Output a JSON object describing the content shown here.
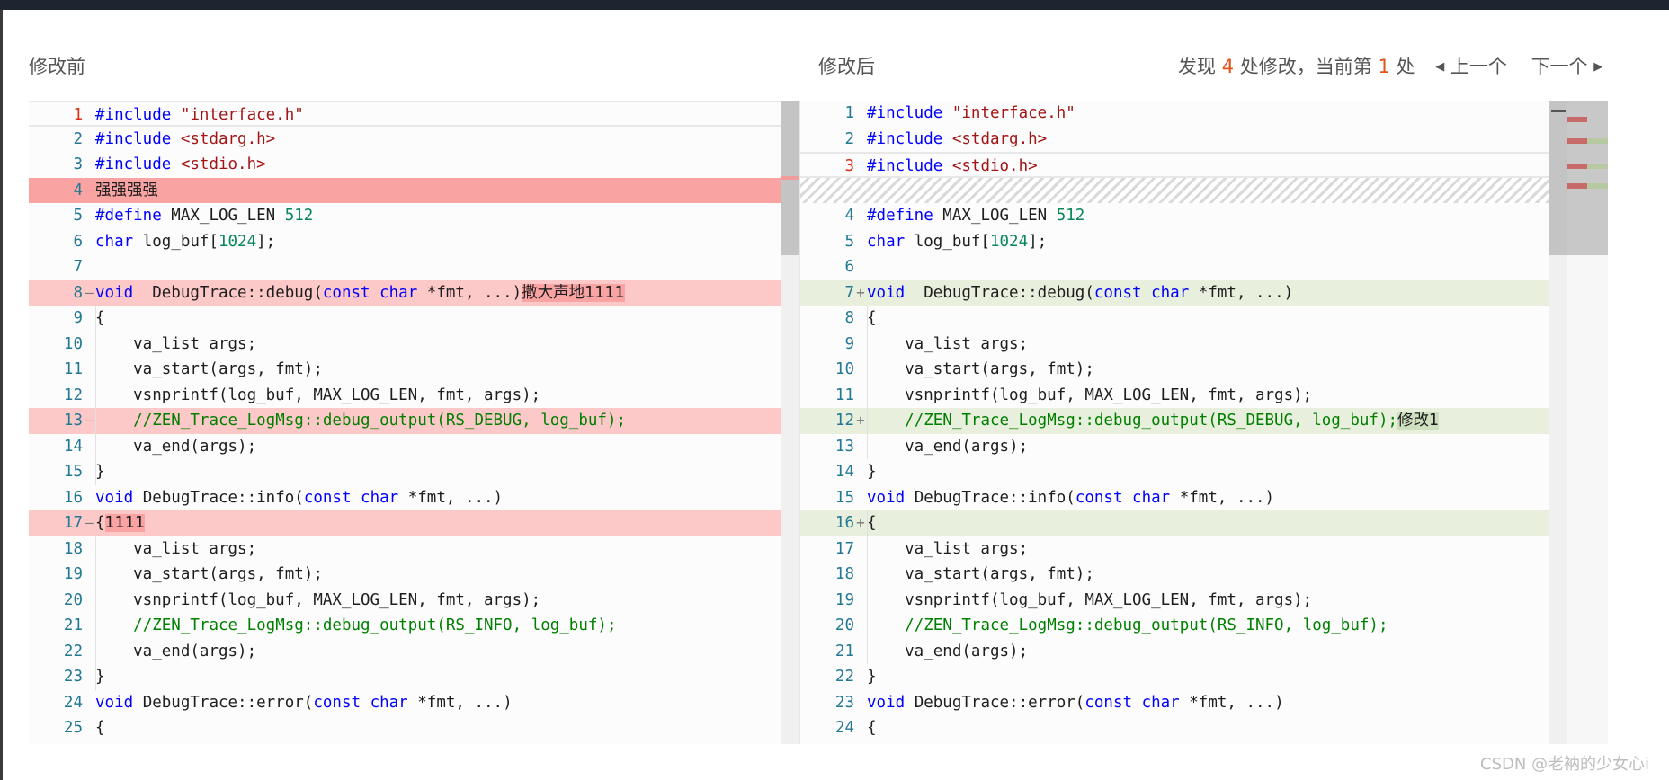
{
  "left_panel": {
    "title": "修改前"
  },
  "right_panel": {
    "title": "修改后"
  },
  "nav": {
    "prefix": "发现",
    "count": "4",
    "middle": "处修改，当前第",
    "current": "1",
    "suffix": "处",
    "prev_label": "上一个",
    "next_label": "下一个",
    "prev_icon": "caret-left-icon",
    "next_icon": "caret-right-icon"
  },
  "colors": {
    "deleted_line": "#fdc8c8",
    "deleted_char": "#f9a3a3",
    "inserted_line": "#e8efdc",
    "line_number": "#237893",
    "active_line_number": "#e02b15",
    "keyword": "#0000ff",
    "string": "#a31515",
    "number": "#098658",
    "comment": "#008000",
    "nav_highlight": "#e5511c"
  },
  "left_lines": [
    {
      "n": "1",
      "mark": "",
      "type": "cur",
      "active": true,
      "tokens": [
        [
          "kw",
          "#include"
        ],
        [
          "t",
          " "
        ],
        [
          "str",
          "\"interface.h\""
        ]
      ]
    },
    {
      "n": "2",
      "mark": "",
      "type": "",
      "tokens": [
        [
          "kw",
          "#include"
        ],
        [
          "t",
          " "
        ],
        [
          "str",
          "<stdarg.h>"
        ]
      ]
    },
    {
      "n": "3",
      "mark": "",
      "type": "",
      "tokens": [
        [
          "kw",
          "#include"
        ],
        [
          "t",
          " "
        ],
        [
          "str",
          "<stdio.h>"
        ]
      ]
    },
    {
      "n": "4",
      "mark": "—",
      "type": "del-strong",
      "tokens": [
        [
          "cjk",
          "强强强强"
        ]
      ]
    },
    {
      "n": "5",
      "mark": "",
      "type": "",
      "tokens": [
        [
          "kw",
          "#define"
        ],
        [
          "t",
          " MAX_LOG_LEN "
        ],
        [
          "num",
          "512"
        ]
      ]
    },
    {
      "n": "6",
      "mark": "",
      "type": "",
      "tokens": [
        [
          "kw",
          "char"
        ],
        [
          "t",
          " log_buf["
        ],
        [
          "num",
          "1024"
        ],
        [
          "t",
          "];"
        ]
      ]
    },
    {
      "n": "7",
      "mark": "",
      "type": "",
      "tokens": []
    },
    {
      "n": "8",
      "mark": "—",
      "type": "del",
      "tokens": [
        [
          "kw",
          "void"
        ],
        [
          "t",
          "  DebugTrace::debug("
        ],
        [
          "kw",
          "const"
        ],
        [
          "t",
          " "
        ],
        [
          "kw",
          "char"
        ],
        [
          "t",
          " *fmt, ...)"
        ],
        [
          "del",
          "撒大声地1111"
        ]
      ]
    },
    {
      "n": "9",
      "mark": "",
      "type": "",
      "tokens": [
        [
          "t",
          "{"
        ]
      ]
    },
    {
      "n": "10",
      "mark": "",
      "type": "",
      "tokens": [
        [
          "t",
          "    va_list args;"
        ]
      ]
    },
    {
      "n": "11",
      "mark": "",
      "type": "",
      "tokens": [
        [
          "t",
          "    va_start(args, fmt);"
        ]
      ]
    },
    {
      "n": "12",
      "mark": "",
      "type": "",
      "tokens": [
        [
          "t",
          "    vsnprintf(log_buf, MAX_LOG_LEN, fmt, args);"
        ]
      ]
    },
    {
      "n": "13",
      "mark": "—",
      "type": "del",
      "tokens": [
        [
          "t",
          "    "
        ],
        [
          "cmt",
          "//ZEN_Trace_LogMsg::debug_output(RS_DEBUG, log_buf);"
        ]
      ]
    },
    {
      "n": "14",
      "mark": "",
      "type": "",
      "tokens": [
        [
          "t",
          "    va_end(args);"
        ]
      ]
    },
    {
      "n": "15",
      "mark": "",
      "type": "",
      "tokens": [
        [
          "t",
          "}"
        ]
      ]
    },
    {
      "n": "16",
      "mark": "",
      "type": "",
      "tokens": [
        [
          "kw",
          "void"
        ],
        [
          "t",
          " DebugTrace::info("
        ],
        [
          "kw",
          "const"
        ],
        [
          "t",
          " "
        ],
        [
          "kw",
          "char"
        ],
        [
          "t",
          " *fmt, ...)"
        ]
      ]
    },
    {
      "n": "17",
      "mark": "—",
      "type": "del",
      "tokens": [
        [
          "t",
          "{"
        ],
        [
          "del",
          "1111"
        ]
      ]
    },
    {
      "n": "18",
      "mark": "",
      "type": "",
      "tokens": [
        [
          "t",
          "    va_list args;"
        ]
      ]
    },
    {
      "n": "19",
      "mark": "",
      "type": "",
      "tokens": [
        [
          "t",
          "    va_start(args, fmt);"
        ]
      ]
    },
    {
      "n": "20",
      "mark": "",
      "type": "",
      "tokens": [
        [
          "t",
          "    vsnprintf(log_buf, MAX_LOG_LEN, fmt, args);"
        ]
      ]
    },
    {
      "n": "21",
      "mark": "",
      "type": "",
      "tokens": [
        [
          "t",
          "    "
        ],
        [
          "cmt",
          "//ZEN_Trace_LogMsg::debug_output(RS_INFO, log_buf);"
        ]
      ]
    },
    {
      "n": "22",
      "mark": "",
      "type": "",
      "tokens": [
        [
          "t",
          "    va_end(args);"
        ]
      ]
    },
    {
      "n": "23",
      "mark": "",
      "type": "",
      "tokens": [
        [
          "t",
          "}"
        ]
      ]
    },
    {
      "n": "24",
      "mark": "",
      "type": "",
      "tokens": [
        [
          "kw",
          "void"
        ],
        [
          "t",
          " DebugTrace::error("
        ],
        [
          "kw",
          "const"
        ],
        [
          "t",
          " "
        ],
        [
          "kw",
          "char"
        ],
        [
          "t",
          " *fmt, ...)"
        ]
      ]
    },
    {
      "n": "25",
      "mark": "",
      "type": "",
      "tokens": [
        [
          "t",
          "{"
        ]
      ]
    }
  ],
  "right_lines": [
    {
      "n": "1",
      "mark": "",
      "type": "",
      "tokens": [
        [
          "kw",
          "#include"
        ],
        [
          "t",
          " "
        ],
        [
          "str",
          "\"interface.h\""
        ]
      ]
    },
    {
      "n": "2",
      "mark": "",
      "type": "",
      "tokens": [
        [
          "kw",
          "#include"
        ],
        [
          "t",
          " "
        ],
        [
          "str",
          "<stdarg.h>"
        ]
      ]
    },
    {
      "n": "3",
      "mark": "",
      "type": "cur",
      "active": true,
      "tokens": [
        [
          "kw",
          "#include"
        ],
        [
          "t",
          " "
        ],
        [
          "str",
          "<stdio.h>"
        ]
      ]
    },
    {
      "n": "",
      "mark": "",
      "type": "filler",
      "tokens": []
    },
    {
      "n": "4",
      "mark": "",
      "type": "",
      "tokens": [
        [
          "kw",
          "#define"
        ],
        [
          "t",
          " MAX_LOG_LEN "
        ],
        [
          "num",
          "512"
        ]
      ]
    },
    {
      "n": "5",
      "mark": "",
      "type": "",
      "tokens": [
        [
          "kw",
          "char"
        ],
        [
          "t",
          " log_buf["
        ],
        [
          "num",
          "1024"
        ],
        [
          "t",
          "];"
        ]
      ]
    },
    {
      "n": "6",
      "mark": "",
      "type": "",
      "tokens": []
    },
    {
      "n": "7",
      "mark": "+",
      "type": "ins",
      "tokens": [
        [
          "kw",
          "void"
        ],
        [
          "t",
          "  DebugTrace::debug("
        ],
        [
          "kw",
          "const"
        ],
        [
          "t",
          " "
        ],
        [
          "kw",
          "char"
        ],
        [
          "t",
          " *fmt, ...)"
        ]
      ]
    },
    {
      "n": "8",
      "mark": "",
      "type": "",
      "tokens": [
        [
          "t",
          "{"
        ]
      ]
    },
    {
      "n": "9",
      "mark": "",
      "type": "",
      "tokens": [
        [
          "t",
          "    va_list args;"
        ]
      ]
    },
    {
      "n": "10",
      "mark": "",
      "type": "",
      "tokens": [
        [
          "t",
          "    va_start(args, fmt);"
        ]
      ]
    },
    {
      "n": "11",
      "mark": "",
      "type": "",
      "tokens": [
        [
          "t",
          "    vsnprintf(log_buf, MAX_LOG_LEN, fmt, args);"
        ]
      ]
    },
    {
      "n": "12",
      "mark": "+",
      "type": "ins",
      "tokens": [
        [
          "t",
          "    "
        ],
        [
          "cmt",
          "//ZEN_Trace_LogMsg::debug_output(RS_DEBUG, log_buf);"
        ],
        [
          "ins",
          "修改1"
        ]
      ]
    },
    {
      "n": "13",
      "mark": "",
      "type": "",
      "tokens": [
        [
          "t",
          "    va_end(args);"
        ]
      ]
    },
    {
      "n": "14",
      "mark": "",
      "type": "",
      "tokens": [
        [
          "t",
          "}"
        ]
      ]
    },
    {
      "n": "15",
      "mark": "",
      "type": "",
      "tokens": [
        [
          "kw",
          "void"
        ],
        [
          "t",
          " DebugTrace::info("
        ],
        [
          "kw",
          "const"
        ],
        [
          "t",
          " "
        ],
        [
          "kw",
          "char"
        ],
        [
          "t",
          " *fmt, ...)"
        ]
      ]
    },
    {
      "n": "16",
      "mark": "+",
      "type": "ins",
      "tokens": [
        [
          "t",
          "{"
        ]
      ]
    },
    {
      "n": "17",
      "mark": "",
      "type": "",
      "tokens": [
        [
          "t",
          "    va_list args;"
        ]
      ]
    },
    {
      "n": "18",
      "mark": "",
      "type": "",
      "tokens": [
        [
          "t",
          "    va_start(args, fmt);"
        ]
      ]
    },
    {
      "n": "19",
      "mark": "",
      "type": "",
      "tokens": [
        [
          "t",
          "    vsnprintf(log_buf, MAX_LOG_LEN, fmt, args);"
        ]
      ]
    },
    {
      "n": "20",
      "mark": "",
      "type": "",
      "tokens": [
        [
          "t",
          "    "
        ],
        [
          "cmt",
          "//ZEN_Trace_LogMsg::debug_output(RS_INFO, log_buf);"
        ]
      ]
    },
    {
      "n": "21",
      "mark": "",
      "type": "",
      "tokens": [
        [
          "t",
          "    va_end(args);"
        ]
      ]
    },
    {
      "n": "22",
      "mark": "",
      "type": "",
      "tokens": [
        [
          "t",
          "}"
        ]
      ]
    },
    {
      "n": "23",
      "mark": "",
      "type": "",
      "tokens": [
        [
          "kw",
          "void"
        ],
        [
          "t",
          " DebugTrace::error("
        ],
        [
          "kw",
          "const"
        ],
        [
          "t",
          " "
        ],
        [
          "kw",
          "char"
        ],
        [
          "t",
          " *fmt, ...)"
        ]
      ]
    },
    {
      "n": "24",
      "mark": "",
      "type": "",
      "tokens": [
        [
          "t",
          "{"
        ]
      ]
    }
  ],
  "watermark": "CSDN @老衲的少女心i"
}
